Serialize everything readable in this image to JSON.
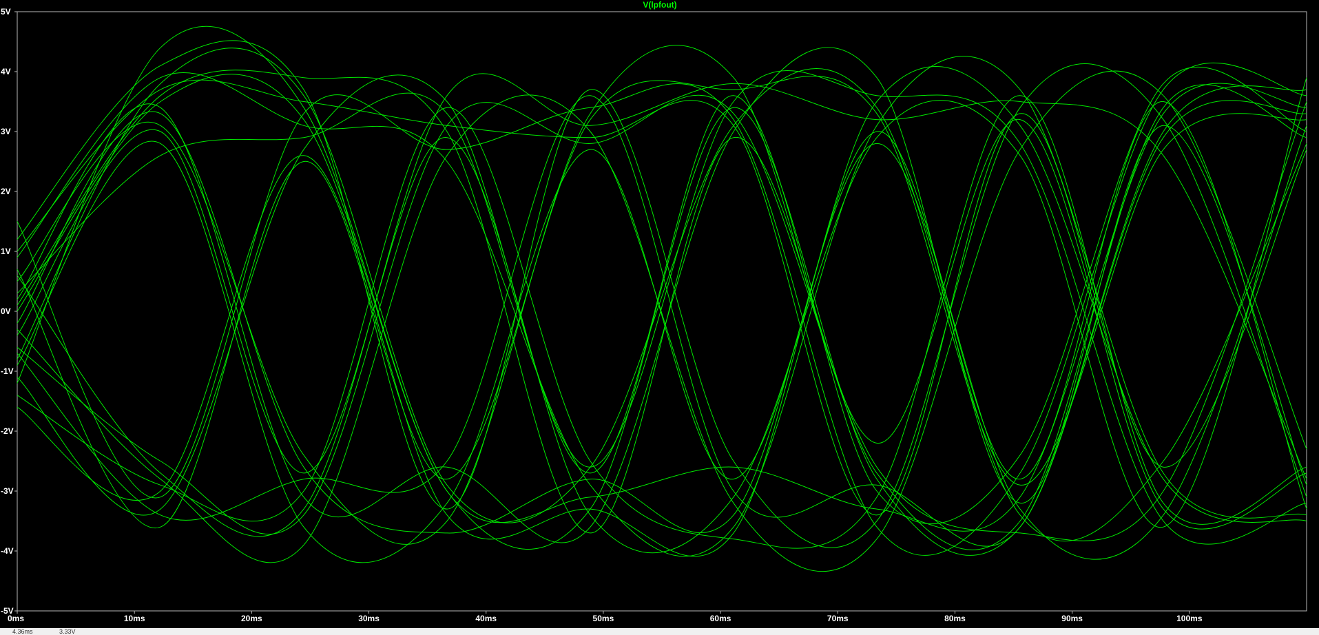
{
  "colors": {
    "background": "#000000",
    "trace": "#00e800",
    "frame": "#b8b8b8",
    "text": "#ffffff",
    "title": "#00ff00",
    "status_bg": "#f0f0f0",
    "status_text": "#303030"
  },
  "status": {
    "left_value": "4.36ms",
    "right_value": "3.33V"
  },
  "chart_data": {
    "type": "line",
    "title": "V(lpfout)",
    "xlabel": "",
    "ylabel": "",
    "grid": false,
    "xlim": [
      0,
      110
    ],
    "ylim": [
      -5,
      5
    ],
    "x_unit": "ms",
    "y_unit": "V",
    "xticks": [
      0,
      10,
      20,
      30,
      40,
      50,
      60,
      70,
      80,
      90,
      100
    ],
    "xtick_labels": [
      "0ms",
      "10ms",
      "20ms",
      "30ms",
      "40ms",
      "50ms",
      "60ms",
      "70ms",
      "80ms",
      "90ms",
      "100ms"
    ],
    "yticks": [
      5,
      4,
      3,
      2,
      1,
      0,
      -1,
      -2,
      -3,
      -4,
      -5
    ],
    "ytick_labels": [
      "5V",
      "4V",
      "3V",
      "2V",
      "1V",
      "0V",
      "-1V",
      "-2V",
      "-3V",
      "-4V",
      "-5V"
    ],
    "series": [
      {
        "values": [
          0.0,
          3.5,
          3.2,
          -3.0,
          -3.3,
          3.4,
          -2.8,
          -3.6,
          2.9,
          3.3
        ]
      },
      {
        "values": [
          -0.8,
          3.8,
          3.6,
          -2.9,
          -2.6,
          3.1,
          3.4,
          -3.4,
          -2.5,
          2.8
        ]
      },
      {
        "values": [
          0.5,
          3.1,
          -2.4,
          -3.5,
          3.3,
          3.9,
          -2.2,
          3.2,
          -3.3,
          -2.7
        ]
      },
      {
        "values": [
          -0.3,
          -2.8,
          -3.9,
          2.6,
          3.0,
          -3.2,
          -3.8,
          2.7,
          3.6,
          -2.3
        ]
      },
      {
        "values": [
          0.9,
          3.9,
          3.1,
          2.5,
          -2.9,
          -3.6,
          3.1,
          3.7,
          -2.7,
          -3.4
        ]
      },
      {
        "values": [
          -1.1,
          -3.3,
          2.7,
          3.5,
          -2.7,
          3.6,
          -3.0,
          -2.4,
          3.8,
          3.0
        ]
      },
      {
        "values": [
          0.2,
          3.4,
          -3.1,
          -2.6,
          -3.6,
          3.0,
          3.9,
          -3.2,
          3.1,
          -2.9
        ]
      },
      {
        "values": [
          -0.6,
          -2.5,
          -3.4,
          3.1,
          2.8,
          3.3,
          -2.6,
          -3.7,
          -3.0,
          3.5
        ]
      },
      {
        "values": [
          1.2,
          4.1,
          3.7,
          -3.3,
          3.7,
          -2.5,
          -3.5,
          3.4,
          3.2,
          -3.1
        ]
      },
      {
        "values": [
          -0.4,
          3.0,
          -2.7,
          2.9,
          -3.4,
          -3.1,
          2.9,
          2.6,
          -3.6,
          3.9
        ]
      },
      {
        "values": [
          0.7,
          -3.6,
          2.5,
          -2.8,
          3.2,
          3.7,
          3.3,
          -2.9,
          2.7,
          3.2
        ]
      },
      {
        "values": [
          -1.4,
          -2.9,
          -3.0,
          3.4,
          -2.5,
          -3.8,
          -3.1,
          3.6,
          -3.2,
          -2.6
        ]
      },
      {
        "values": [
          0.1,
          3.6,
          3.9,
          3.0,
          -3.7,
          2.9,
          -2.7,
          -3.5,
          3.4,
          2.9
        ]
      },
      {
        "values": [
          -0.9,
          2.8,
          -3.6,
          -3.2,
          2.7,
          -2.8,
          3.5,
          3.1,
          -2.8,
          -3.5
        ]
      },
      {
        "values": [
          1.5,
          -3.1,
          3.3,
          2.7,
          3.4,
          3.2,
          -3.6,
          -2.7,
          3.7,
          3.6
        ]
      },
      {
        "values": [
          -0.2,
          3.3,
          -2.6,
          -3.7,
          -2.8,
          -3.4,
          2.8,
          -3.3,
          -3.4,
          3.1
        ]
      },
      {
        "values": [
          0.6,
          -2.7,
          -3.3,
          3.6,
          3.1,
          3.8,
          3.2,
          3.5,
          2.6,
          -2.8
        ]
      },
      {
        "values": [
          -1.2,
          4.4,
          3.4,
          -3.0,
          -3.1,
          -2.6,
          -3.3,
          -3.1,
          3.3,
          3.4
        ]
      },
      {
        "values": [
          0.3,
          2.6,
          2.9,
          3.3,
          -2.6,
          3.5,
          3.6,
          2.8,
          -3.5,
          -3.2
        ]
      },
      {
        "values": [
          -0.7,
          -3.4,
          -2.8,
          -2.5,
          3.6,
          -3.0,
          -2.9,
          -3.6,
          3.0,
          3.7
        ]
      },
      {
        "values": [
          1.0,
          3.7,
          3.5,
          3.1,
          2.9,
          3.1,
          -3.4,
          3.3,
          -2.6,
          2.7
        ]
      },
      {
        "values": [
          -1.6,
          -3.0,
          2.6,
          -3.4,
          -3.3,
          -3.7,
          3.0,
          -2.8,
          3.5,
          -3.3
        ]
      }
    ]
  }
}
